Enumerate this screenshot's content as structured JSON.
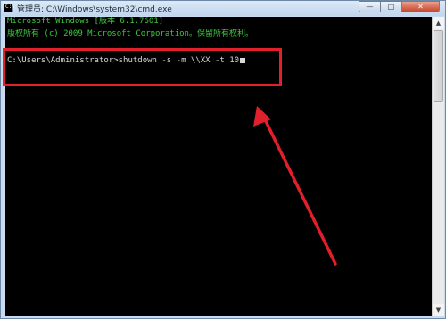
{
  "window": {
    "title": "管理员: C:\\Windows\\system32\\cmd.exe",
    "icon": "cmd-icon",
    "caption": {
      "minimize": "—",
      "maximize": "□",
      "close": "✕"
    }
  },
  "console": {
    "lines": [
      "Microsoft Windows [版本 6.1.7601]",
      "版权所有 (c) 2009 Microsoft Corporation。保留所有权利。",
      "",
      "C:\\Users\\Administrator>shutdown -s -m \\\\XX -t 10"
    ],
    "text_colors": {
      "banner": "#3cc83c",
      "command": "#d8d8d8"
    },
    "background": "#000000"
  },
  "annotation": {
    "color": "#e0202a",
    "shape": "rectangle-and-arrow"
  }
}
